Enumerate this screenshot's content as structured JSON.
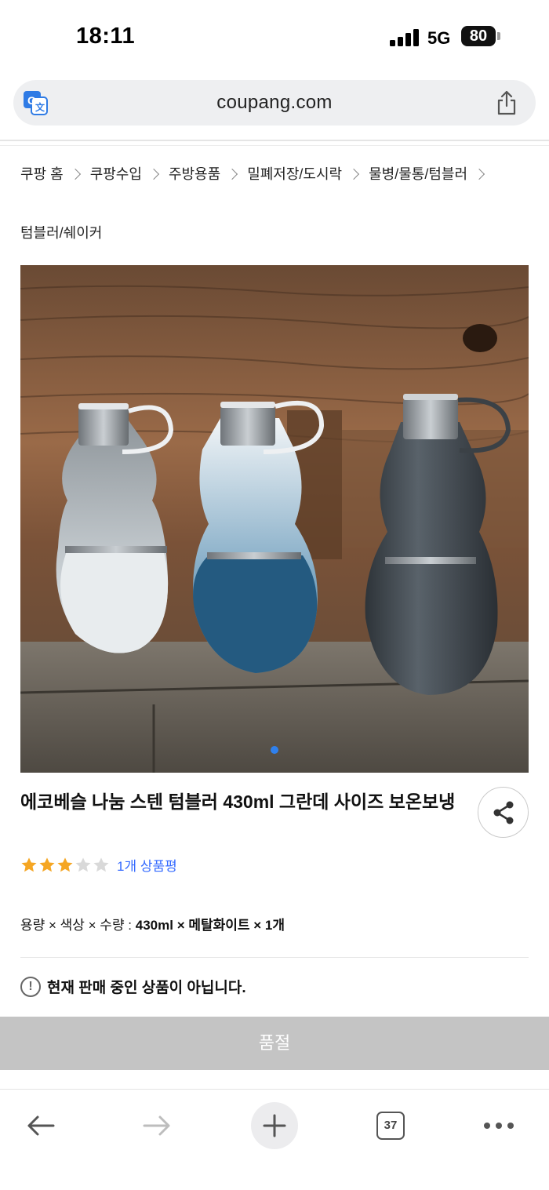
{
  "status_bar": {
    "time": "18:11",
    "network": "5G",
    "battery": "80"
  },
  "browser": {
    "url": "coupang.com",
    "tab_count": "37"
  },
  "breadcrumb": {
    "items": [
      "쿠팡 홈",
      "쿠팡수입",
      "주방용품",
      "밀폐저장/도시락",
      "물병/물통/텀블러"
    ],
    "last": "텀블러/쉐이커"
  },
  "product": {
    "title": "에코베슬 나눔 스텐 텀블러 430ml 그란데 사이즈 보온보냉",
    "rating": 3,
    "rating_max": 5,
    "review_text": "1개 상품평",
    "options_label": "용량 × 색상 × 수량 : ",
    "options_value": "430ml × 메탈화이트 × 1개",
    "image_count": 1,
    "image_index": 1
  },
  "notice": {
    "icon": "!",
    "text": "현재 판매 중인 상품이 아닙니다."
  },
  "sold_out_label": "품절",
  "colors": {
    "link": "#346aff",
    "star": "#f5a623",
    "star_empty": "#d9d9d9",
    "sold_out_bg": "#c4c4c4",
    "url_bar_bg": "#eeeff1",
    "dot_active": "#2f80ed"
  },
  "icons": {
    "translate": "translate-icon",
    "share_url": "share-icon",
    "share_product": "share-nodes-icon",
    "back": "arrow-left-icon",
    "forward": "arrow-right-icon",
    "new_tab": "plus-icon",
    "tabs": "tabs-icon",
    "more": "more-dots-icon"
  }
}
